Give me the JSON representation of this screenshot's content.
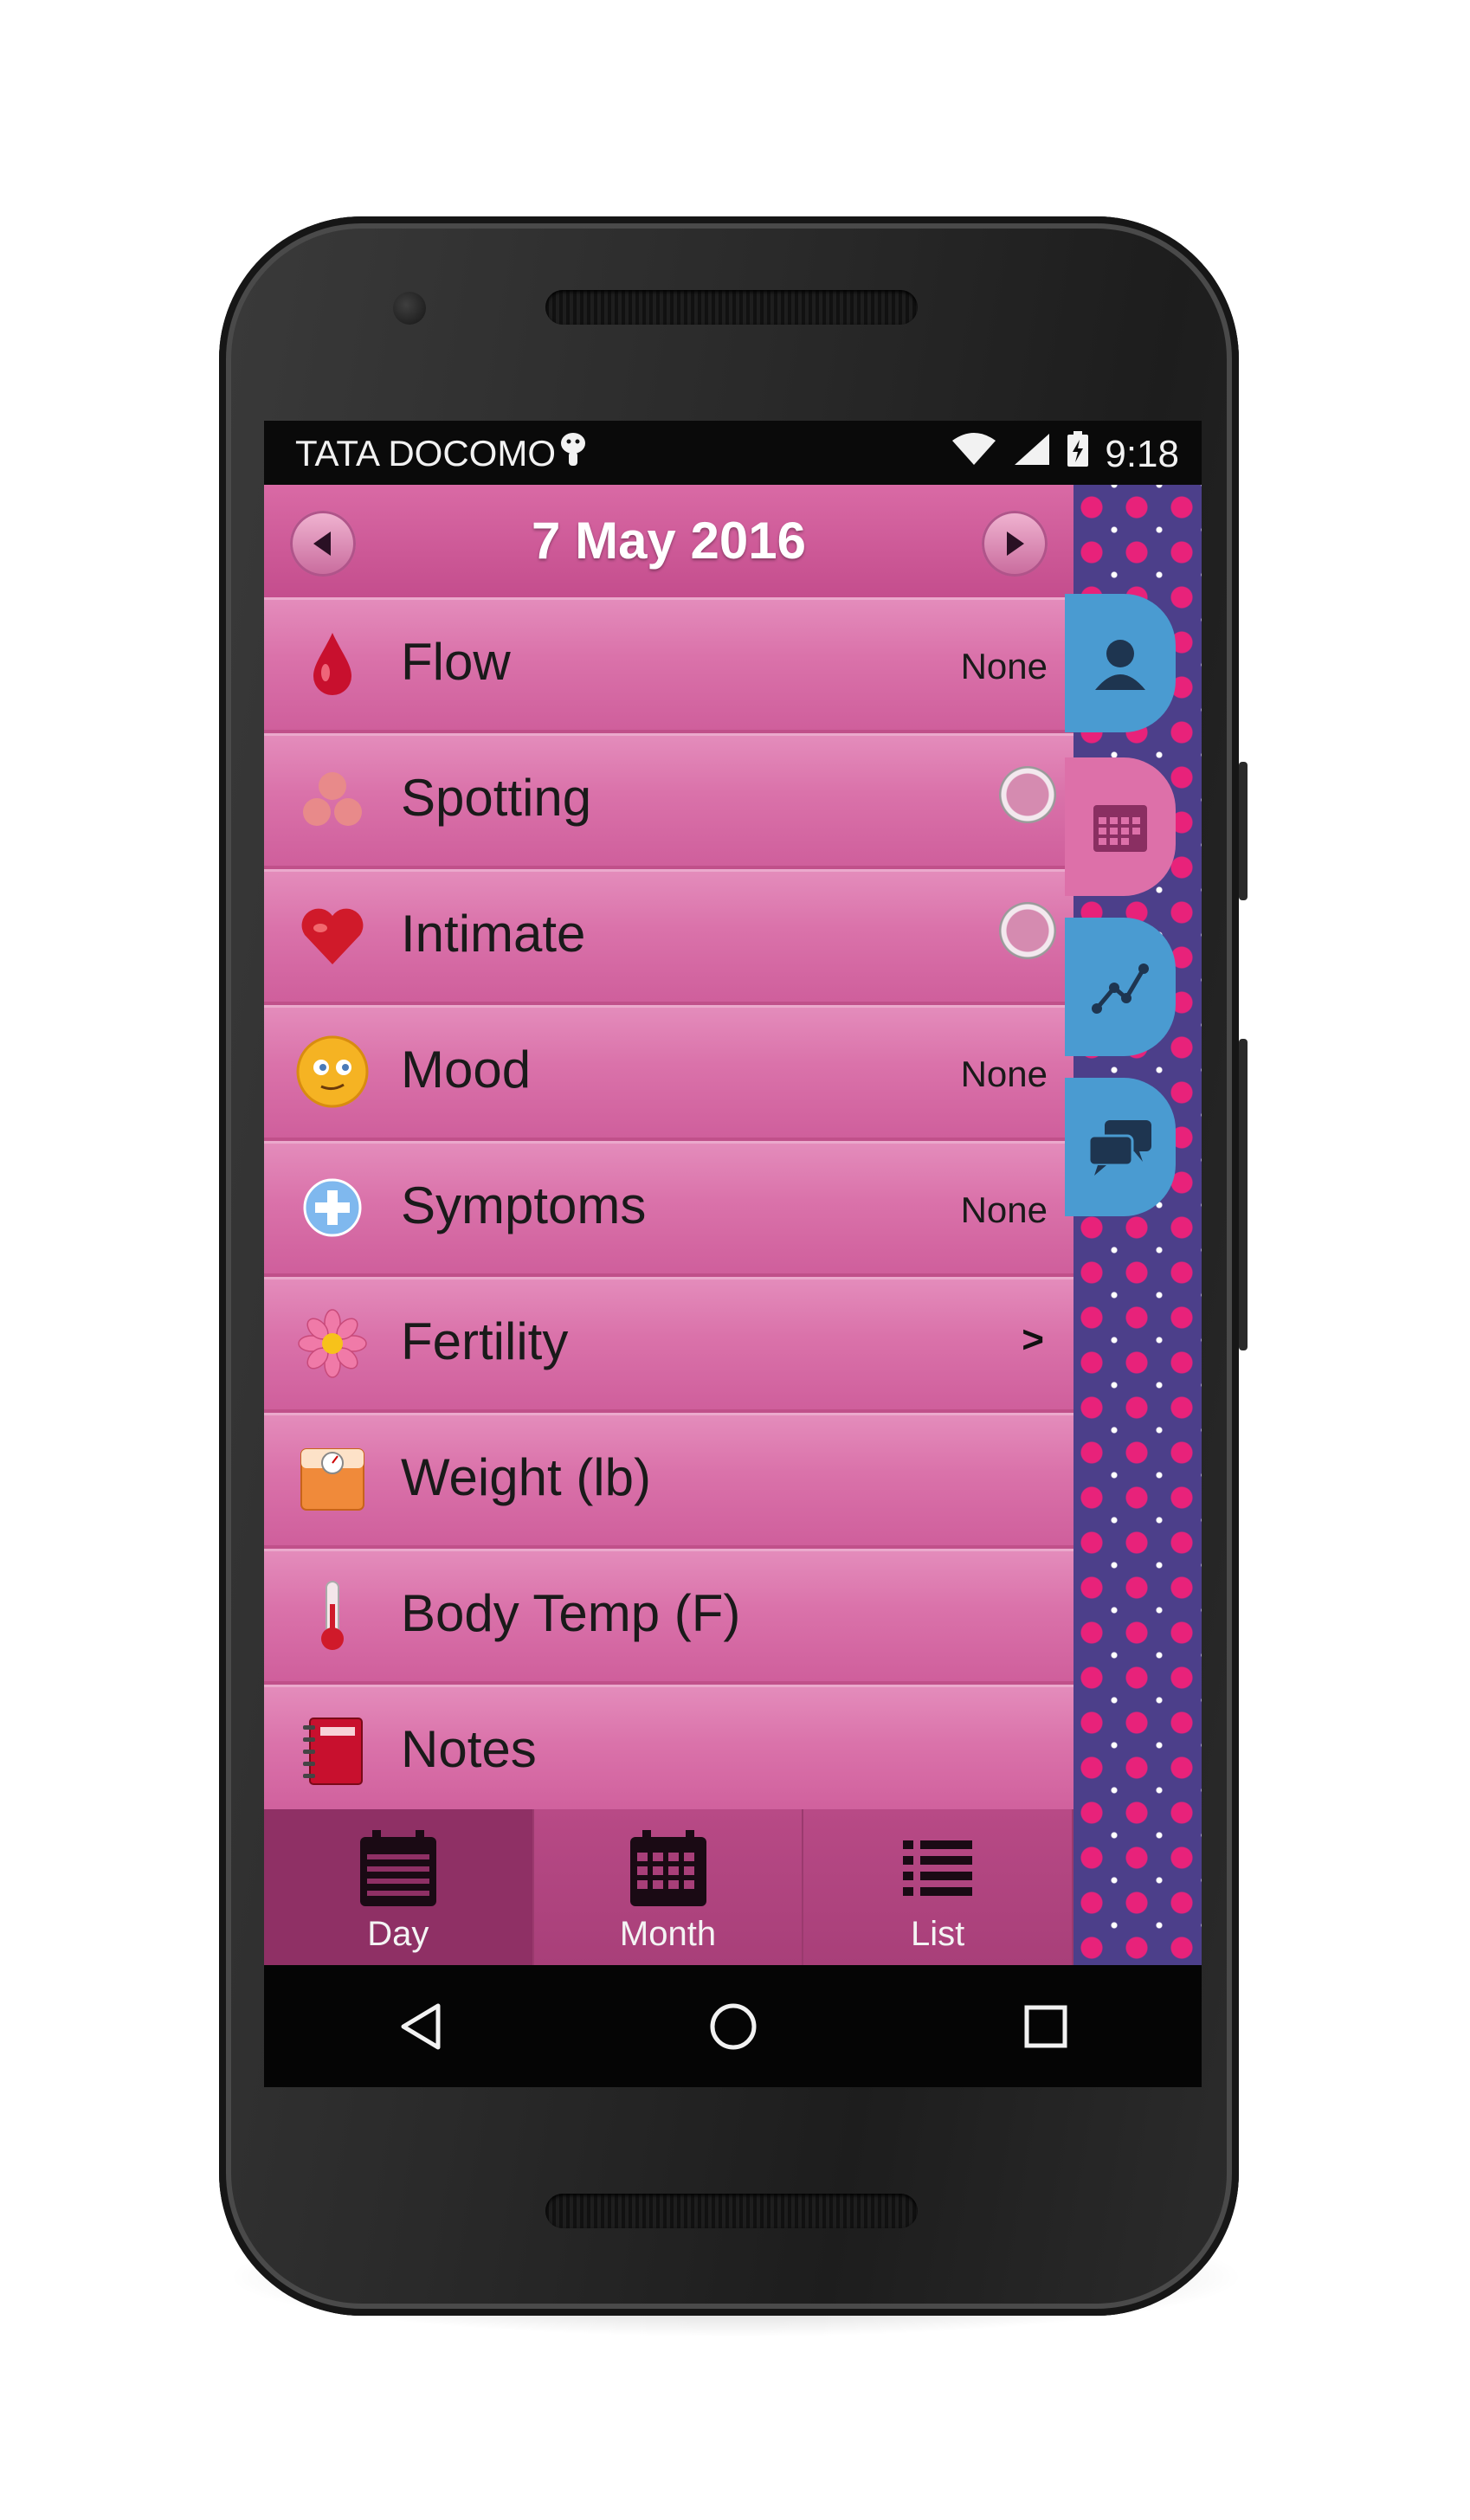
{
  "status_bar": {
    "carrier": "TATA DOCOMO",
    "time": "9:18",
    "icons": [
      "android-icon",
      "wifi-icon",
      "signal-icon",
      "battery-charging-icon"
    ]
  },
  "header": {
    "date": "7 May 2016",
    "prev_icon": "chevron-left-icon",
    "next_icon": "chevron-right-icon"
  },
  "rows": [
    {
      "label": "Flow",
      "value": "None",
      "icon": "blood-drop-icon"
    },
    {
      "label": "Spotting",
      "value": "",
      "icon": "spots-icon",
      "control": "radio"
    },
    {
      "label": "Intimate",
      "value": "",
      "icon": "heart-icon",
      "control": "radio"
    },
    {
      "label": "Mood",
      "value": "None",
      "icon": "smiley-icon"
    },
    {
      "label": "Symptoms",
      "value": "None",
      "icon": "plus-icon"
    },
    {
      "label": "Fertility",
      "value": ">",
      "icon": "flower-icon"
    },
    {
      "label": "Weight (lb)",
      "value": "",
      "icon": "scale-icon"
    },
    {
      "label": "Body Temp (F)",
      "value": "",
      "icon": "thermometer-icon"
    },
    {
      "label": "Notes",
      "value": "",
      "icon": "notebook-icon"
    }
  ],
  "side_tabs": [
    {
      "icon": "profile-icon",
      "color": "#4a9bd1"
    },
    {
      "icon": "calendar-icon",
      "color": "#dd70a9"
    },
    {
      "icon": "chart-icon",
      "color": "#4a9bd1"
    },
    {
      "icon": "chat-icon",
      "color": "#4a9bd1"
    }
  ],
  "bottom_tabs": [
    {
      "label": "Day",
      "icon": "day-calendar-icon",
      "active": true
    },
    {
      "label": "Month",
      "icon": "month-calendar-icon",
      "active": false
    },
    {
      "label": "List",
      "icon": "list-icon",
      "active": false
    }
  ],
  "nav_bar": [
    "back-icon",
    "home-icon",
    "recents-icon"
  ],
  "colors": {
    "row_pink": "#da72aa",
    "header_pink": "#c44d8d",
    "pattern_purple": "#4c3f8a",
    "pattern_dot": "#e8227a",
    "tab_blue": "#4a9bd1"
  }
}
